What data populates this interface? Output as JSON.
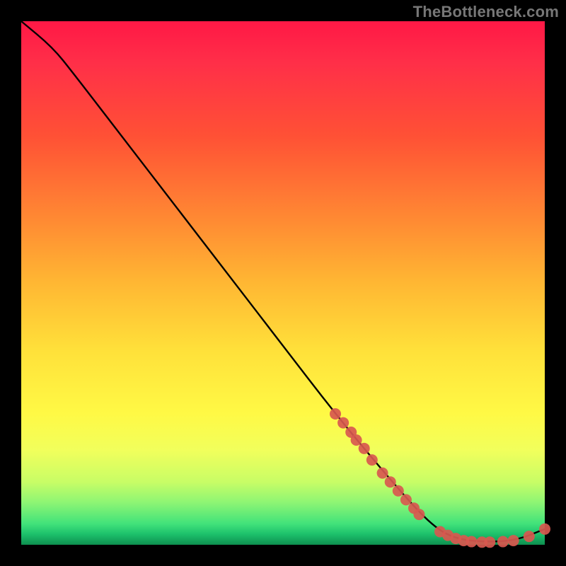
{
  "attribution": "TheBottleneck.com",
  "chart_data": {
    "type": "line",
    "title": "",
    "xlabel": "",
    "ylabel": "",
    "xlim": [
      0,
      100
    ],
    "ylim": [
      0,
      100
    ],
    "curve": [
      {
        "x": 0,
        "y": 100
      },
      {
        "x": 6,
        "y": 95
      },
      {
        "x": 10,
        "y": 90
      },
      {
        "x": 20,
        "y": 77
      },
      {
        "x": 30,
        "y": 64
      },
      {
        "x": 40,
        "y": 51
      },
      {
        "x": 50,
        "y": 38
      },
      {
        "x": 60,
        "y": 25
      },
      {
        "x": 70,
        "y": 13
      },
      {
        "x": 78,
        "y": 4
      },
      {
        "x": 83,
        "y": 1
      },
      {
        "x": 90,
        "y": 0.5
      },
      {
        "x": 95,
        "y": 1
      },
      {
        "x": 100,
        "y": 3
      }
    ],
    "markers": [
      {
        "x": 60.0,
        "y": 25.0
      },
      {
        "x": 61.5,
        "y": 23.3
      },
      {
        "x": 63.0,
        "y": 21.5
      },
      {
        "x": 64.0,
        "y": 20.0
      },
      {
        "x": 65.5,
        "y": 18.4
      },
      {
        "x": 67.0,
        "y": 16.2
      },
      {
        "x": 69.0,
        "y": 13.7
      },
      {
        "x": 70.5,
        "y": 12.0
      },
      {
        "x": 72.0,
        "y": 10.3
      },
      {
        "x": 73.5,
        "y": 8.6
      },
      {
        "x": 75.0,
        "y": 7.0
      },
      {
        "x": 76.0,
        "y": 5.8
      },
      {
        "x": 80.0,
        "y": 2.5
      },
      {
        "x": 81.5,
        "y": 1.8
      },
      {
        "x": 83.0,
        "y": 1.2
      },
      {
        "x": 84.5,
        "y": 0.8
      },
      {
        "x": 86.0,
        "y": 0.6
      },
      {
        "x": 88.0,
        "y": 0.5
      },
      {
        "x": 89.5,
        "y": 0.5
      },
      {
        "x": 92.0,
        "y": 0.6
      },
      {
        "x": 94.0,
        "y": 0.8
      },
      {
        "x": 97.0,
        "y": 1.6
      },
      {
        "x": 100.0,
        "y": 3.0
      }
    ],
    "marker_color": "#d8584f",
    "line_color": "#000000"
  }
}
